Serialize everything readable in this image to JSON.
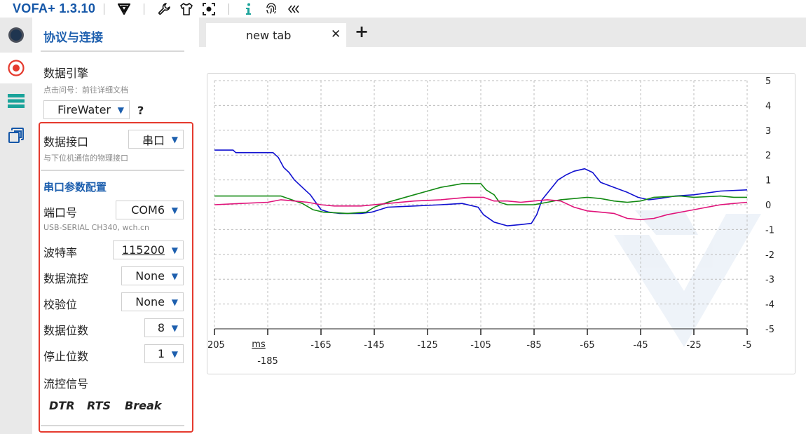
{
  "app": {
    "title": "VOFA+ 1.3.10"
  },
  "toolbar": {
    "icons": [
      "vofa-logo-icon",
      "wrench-icon",
      "shirt-icon",
      "screenshot-icon",
      "info-icon",
      "fingerprint-icon",
      "collapse-icon"
    ]
  },
  "sidebar_strip": [
    "connection-icon",
    "record-icon",
    "list-icon",
    "windows-icon"
  ],
  "panel": {
    "title": "协议与连接",
    "engine": {
      "label": "数据引擎",
      "hint": "点击问号：前往详细文档",
      "value": "FireWater",
      "help": "?"
    },
    "interface": {
      "label": "数据接口",
      "value": "串口",
      "hint": "与下位机通信的物理接口"
    },
    "serial": {
      "section_title": "串口参数配置",
      "port_label": "端口号",
      "port_value": "COM6",
      "port_hint": "USB-SERIAL CH340, wch.cn",
      "baud_label": "波特率",
      "baud_value": "115200",
      "flow_label": "数据流控",
      "flow_value": "None",
      "parity_label": "校验位",
      "parity_value": "None",
      "databits_label": "数据位数",
      "databits_value": "8",
      "stopbits_label": "停止位数",
      "stopbits_value": "1",
      "flowsignal_label": "流控信号",
      "dtr": "DTR",
      "rts": "RTS",
      "brk": "Break"
    }
  },
  "tabs": [
    {
      "label": "new tab",
      "close": "✕"
    }
  ],
  "tab_add": "+",
  "chart_data": {
    "type": "line",
    "x_unit_label": "ms",
    "xlim": [
      -205,
      -5
    ],
    "ylim": [
      -5,
      5
    ],
    "x_ticks": [
      -205,
      -185,
      -165,
      -145,
      -125,
      -105,
      -85,
      -65,
      -45,
      -25,
      -5
    ],
    "y_ticks": [
      5,
      4,
      3,
      2,
      1,
      0,
      -1,
      -2,
      -3,
      -4,
      -5
    ],
    "grid": true,
    "colors": {
      "blue": "#1010d0",
      "green": "#138a13",
      "pink": "#e0137a"
    },
    "series": [
      {
        "color": "blue",
        "points": [
          [
            -205,
            2.2
          ],
          [
            -198,
            2.2
          ],
          [
            -197,
            2.1
          ],
          [
            -183,
            2.1
          ],
          [
            -181,
            1.9
          ],
          [
            -179,
            1.5
          ],
          [
            -177,
            1.3
          ],
          [
            -175,
            1.0
          ],
          [
            -173,
            0.8
          ],
          [
            -171,
            0.6
          ],
          [
            -169,
            0.4
          ],
          [
            -167,
            0.1
          ],
          [
            -165,
            -0.2
          ],
          [
            -162,
            -0.3
          ],
          [
            -158,
            -0.35
          ],
          [
            -150,
            -0.35
          ],
          [
            -146,
            -0.3
          ],
          [
            -143,
            -0.2
          ],
          [
            -140,
            -0.1
          ],
          [
            -130,
            -0.05
          ],
          [
            -120,
            0.0
          ],
          [
            -112,
            0.05
          ],
          [
            -106,
            -0.1
          ],
          [
            -104,
            -0.4
          ],
          [
            -100,
            -0.7
          ],
          [
            -95,
            -0.85
          ],
          [
            -90,
            -0.8
          ],
          [
            -86,
            -0.75
          ],
          [
            -84,
            -0.4
          ],
          [
            -82,
            0.2
          ],
          [
            -79,
            0.6
          ],
          [
            -76,
            1.0
          ],
          [
            -73,
            1.2
          ],
          [
            -70,
            1.35
          ],
          [
            -66,
            1.45
          ],
          [
            -63,
            1.3
          ],
          [
            -60,
            0.9
          ],
          [
            -55,
            0.7
          ],
          [
            -50,
            0.5
          ],
          [
            -46,
            0.3
          ],
          [
            -42,
            0.2
          ],
          [
            -38,
            0.25
          ],
          [
            -32,
            0.35
          ],
          [
            -25,
            0.4
          ],
          [
            -15,
            0.55
          ],
          [
            -5,
            0.6
          ]
        ]
      },
      {
        "color": "green",
        "points": [
          [
            -205,
            0.35
          ],
          [
            -180,
            0.35
          ],
          [
            -176,
            0.2
          ],
          [
            -172,
            0.05
          ],
          [
            -168,
            -0.2
          ],
          [
            -164,
            -0.3
          ],
          [
            -155,
            -0.35
          ],
          [
            -148,
            -0.3
          ],
          [
            -145,
            -0.1
          ],
          [
            -140,
            0.1
          ],
          [
            -135,
            0.25
          ],
          [
            -130,
            0.4
          ],
          [
            -125,
            0.55
          ],
          [
            -120,
            0.7
          ],
          [
            -112,
            0.85
          ],
          [
            -105,
            0.85
          ],
          [
            -103,
            0.6
          ],
          [
            -100,
            0.4
          ],
          [
            -98,
            0.1
          ],
          [
            -95,
            0.0
          ],
          [
            -85,
            0.0
          ],
          [
            -80,
            0.1
          ],
          [
            -75,
            0.2
          ],
          [
            -70,
            0.25
          ],
          [
            -65,
            0.3
          ],
          [
            -60,
            0.25
          ],
          [
            -55,
            0.15
          ],
          [
            -50,
            0.1
          ],
          [
            -45,
            0.15
          ],
          [
            -40,
            0.3
          ],
          [
            -30,
            0.35
          ],
          [
            -25,
            0.3
          ],
          [
            -15,
            0.35
          ],
          [
            -10,
            0.3
          ],
          [
            -5,
            0.3
          ]
        ]
      },
      {
        "color": "pink",
        "points": [
          [
            -205,
            0.0
          ],
          [
            -195,
            0.05
          ],
          [
            -185,
            0.1
          ],
          [
            -180,
            0.2
          ],
          [
            -175,
            0.15
          ],
          [
            -170,
            0.1
          ],
          [
            -165,
            0.0
          ],
          [
            -160,
            -0.05
          ],
          [
            -150,
            -0.05
          ],
          [
            -140,
            0.05
          ],
          [
            -130,
            0.15
          ],
          [
            -120,
            0.2
          ],
          [
            -110,
            0.3
          ],
          [
            -104,
            0.3
          ],
          [
            -100,
            0.15
          ],
          [
            -95,
            0.15
          ],
          [
            -90,
            0.1
          ],
          [
            -85,
            0.15
          ],
          [
            -80,
            0.2
          ],
          [
            -75,
            0.15
          ],
          [
            -70,
            -0.1
          ],
          [
            -65,
            -0.25
          ],
          [
            -60,
            -0.3
          ],
          [
            -55,
            -0.35
          ],
          [
            -50,
            -0.55
          ],
          [
            -45,
            -0.6
          ],
          [
            -40,
            -0.55
          ],
          [
            -35,
            -0.4
          ],
          [
            -30,
            -0.3
          ],
          [
            -25,
            -0.2
          ],
          [
            -20,
            -0.1
          ],
          [
            -15,
            0.0
          ],
          [
            -10,
            0.05
          ],
          [
            -5,
            0.1
          ]
        ]
      }
    ]
  }
}
